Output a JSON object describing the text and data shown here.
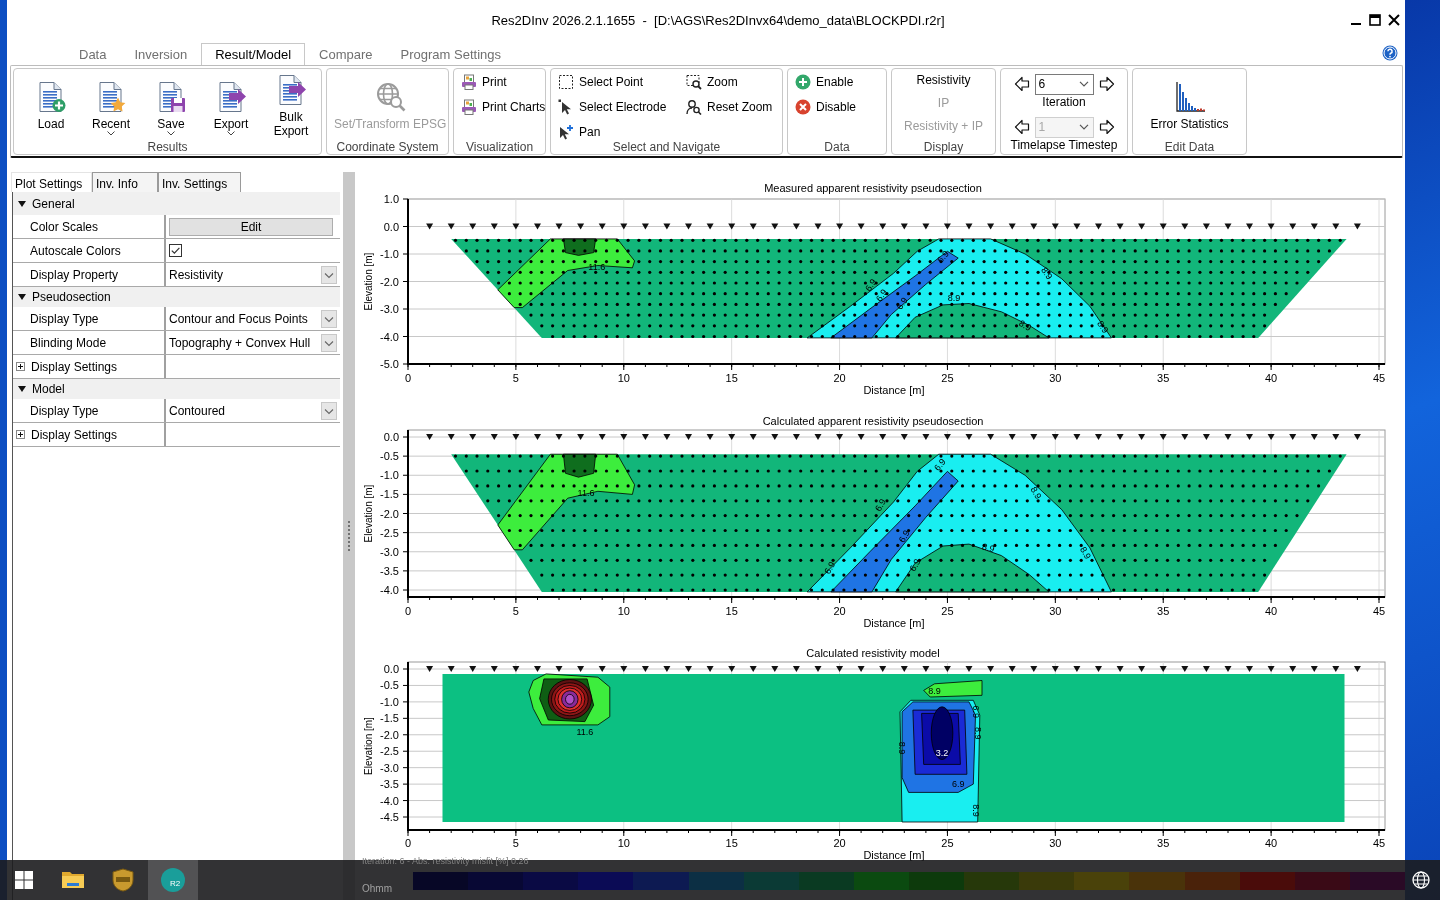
{
  "window": {
    "title": "Res2DInv 2026.2.1.1655  -  [D:\\AGS\\Res2DInvx64\\demo_data\\BLOCKPDI.r2r]"
  },
  "menu_tabs": [
    {
      "label": "Data",
      "selected": false
    },
    {
      "label": "Inversion",
      "selected": false
    },
    {
      "label": "Result/Model",
      "selected": true
    },
    {
      "label": "Compare",
      "selected": false
    },
    {
      "label": "Program Settings",
      "selected": false
    }
  ],
  "ribbon": [
    {
      "label": "Results",
      "kind": "large",
      "buttons": [
        {
          "label": "Load",
          "has_menu": false
        },
        {
          "label": "Recent",
          "has_menu": true
        },
        {
          "label": "Save",
          "has_menu": true
        },
        {
          "label": "Export",
          "has_menu": true
        },
        {
          "label": "Bulk Export",
          "has_menu": false
        }
      ]
    },
    {
      "label": "Coordinate System",
      "kind": "large",
      "buttons": [
        {
          "label": "Set/Transform EPSG",
          "has_menu": false,
          "disabled": true
        }
      ]
    },
    {
      "label": "Visualization",
      "kind": "small",
      "buttons": [
        {
          "label": "Print"
        },
        {
          "label": "Print Charts"
        }
      ]
    },
    {
      "label": "Select and Navigate",
      "kind": "small",
      "buttons": [
        {
          "label": "Select Point"
        },
        {
          "label": "Select Electrode"
        },
        {
          "label": "Pan"
        },
        {
          "label": "Zoom"
        },
        {
          "label": "Reset Zoom"
        }
      ]
    },
    {
      "label": "Data",
      "kind": "small",
      "buttons": [
        {
          "label": "Enable"
        },
        {
          "label": "Disable"
        }
      ]
    },
    {
      "label": "Display",
      "kind": "text",
      "buttons": [
        {
          "label": "Resistivity",
          "disabled": false
        },
        {
          "label": "IP",
          "disabled": true
        },
        {
          "label": "Resistivity + IP",
          "disabled": true
        }
      ]
    },
    {
      "kind": "stepper",
      "steppers": [
        {
          "label": "Iteration",
          "value": "6",
          "disabled": false
        },
        {
          "label": "Timelapse Timestep",
          "value": "1",
          "disabled": true
        }
      ]
    },
    {
      "label": "Edit Data",
      "kind": "large",
      "buttons": [
        {
          "label": "Error Statistics",
          "has_menu": false
        }
      ]
    }
  ],
  "side_panel": {
    "tabs": [
      {
        "label": "Plot Settings",
        "selected": true
      },
      {
        "label": "Inv. Info",
        "selected": false
      },
      {
        "label": "Inv. Settings",
        "selected": false
      }
    ],
    "categories": [
      {
        "label": "General",
        "expanded": true,
        "rows": [
          {
            "kind": "button",
            "label": "Color Scales",
            "value": "Edit"
          },
          {
            "kind": "checkbox",
            "label": "Autoscale Colors",
            "checked": true
          },
          {
            "kind": "dropdown",
            "label": "Display Property",
            "value": "Resistivity"
          }
        ]
      },
      {
        "label": "Pseudosection",
        "expanded": true,
        "rows": [
          {
            "kind": "dropdown",
            "label": "Display Type",
            "value": "Contour and Focus Points"
          },
          {
            "kind": "dropdown",
            "label": "Blinding Mode",
            "value": "Topography + Convex Hull"
          },
          {
            "kind": "group",
            "label": "Display Settings",
            "expanded": false
          }
        ]
      },
      {
        "label": "Model",
        "expanded": true,
        "rows": [
          {
            "kind": "dropdown",
            "label": "Display Type",
            "value": "Contoured"
          },
          {
            "kind": "group",
            "label": "Display Settings",
            "expanded": false
          }
        ]
      }
    ]
  },
  "charts": [
    {
      "kind": "pseudosection",
      "title": "Measured apparent resistivity pseudosection",
      "xlabel": "Distance [m]",
      "ylabel": "Elevation [m]",
      "x_tick_labels": [
        "0",
        "5",
        "10",
        "15",
        "20",
        "25",
        "30",
        "35",
        "40",
        "45"
      ],
      "y_tick_labels": [
        "1.0",
        "0.0",
        "-1.0",
        "-2.0",
        "-3.0",
        "-4.0",
        "-5.0"
      ],
      "contour_labels": [
        "11.6",
        "6.9",
        "6.9",
        "6.9",
        "6.9",
        "8.9",
        "8.9",
        "8.9",
        "8.9"
      ]
    },
    {
      "kind": "pseudosection",
      "title": "Calculated apparent resistivity pseudosection",
      "xlabel": "Distance [m]",
      "ylabel": "Elevation [m]",
      "x_tick_labels": [
        "0",
        "5",
        "10",
        "15",
        "20",
        "25",
        "30",
        "35",
        "40",
        "45"
      ],
      "y_tick_labels": [
        "0.0",
        "-0.5",
        "-1.0",
        "-1.5",
        "-2.0",
        "-2.5",
        "-3.0",
        "-3.5",
        "-4.0"
      ],
      "contour_labels": [
        "11.6",
        "6.9",
        "6.9",
        "6.9",
        "6.9",
        "6.9",
        "8.9",
        "8.9",
        "8.9"
      ]
    },
    {
      "kind": "model",
      "title": "Calculated resistivity model",
      "xlabel": "Distance [m]",
      "ylabel": "Elevation [m]",
      "x_tick_labels": [
        "0",
        "5",
        "10",
        "15",
        "20",
        "25",
        "30",
        "35",
        "40",
        "45"
      ],
      "y_tick_labels": [
        "0.0",
        "-0.5",
        "-1.0",
        "-1.5",
        "-2.0",
        "-2.5",
        "-3.0",
        "-3.5",
        "-4.0",
        "-4.5"
      ],
      "contour_labels": [
        "11.6",
        "8.9",
        "6.9",
        "8.9",
        "8.9",
        "3.2",
        "6.9",
        "8.9"
      ]
    }
  ],
  "status": {
    "misfit": "Iteration: 6 - Abs. resistivity misfit [%] 0.26",
    "unit": "Ohmm"
  },
  "taskbar": {
    "apps": [
      {
        "active": false
      },
      {
        "active": false
      },
      {
        "active": true,
        "badge": "R2"
      }
    ]
  }
}
